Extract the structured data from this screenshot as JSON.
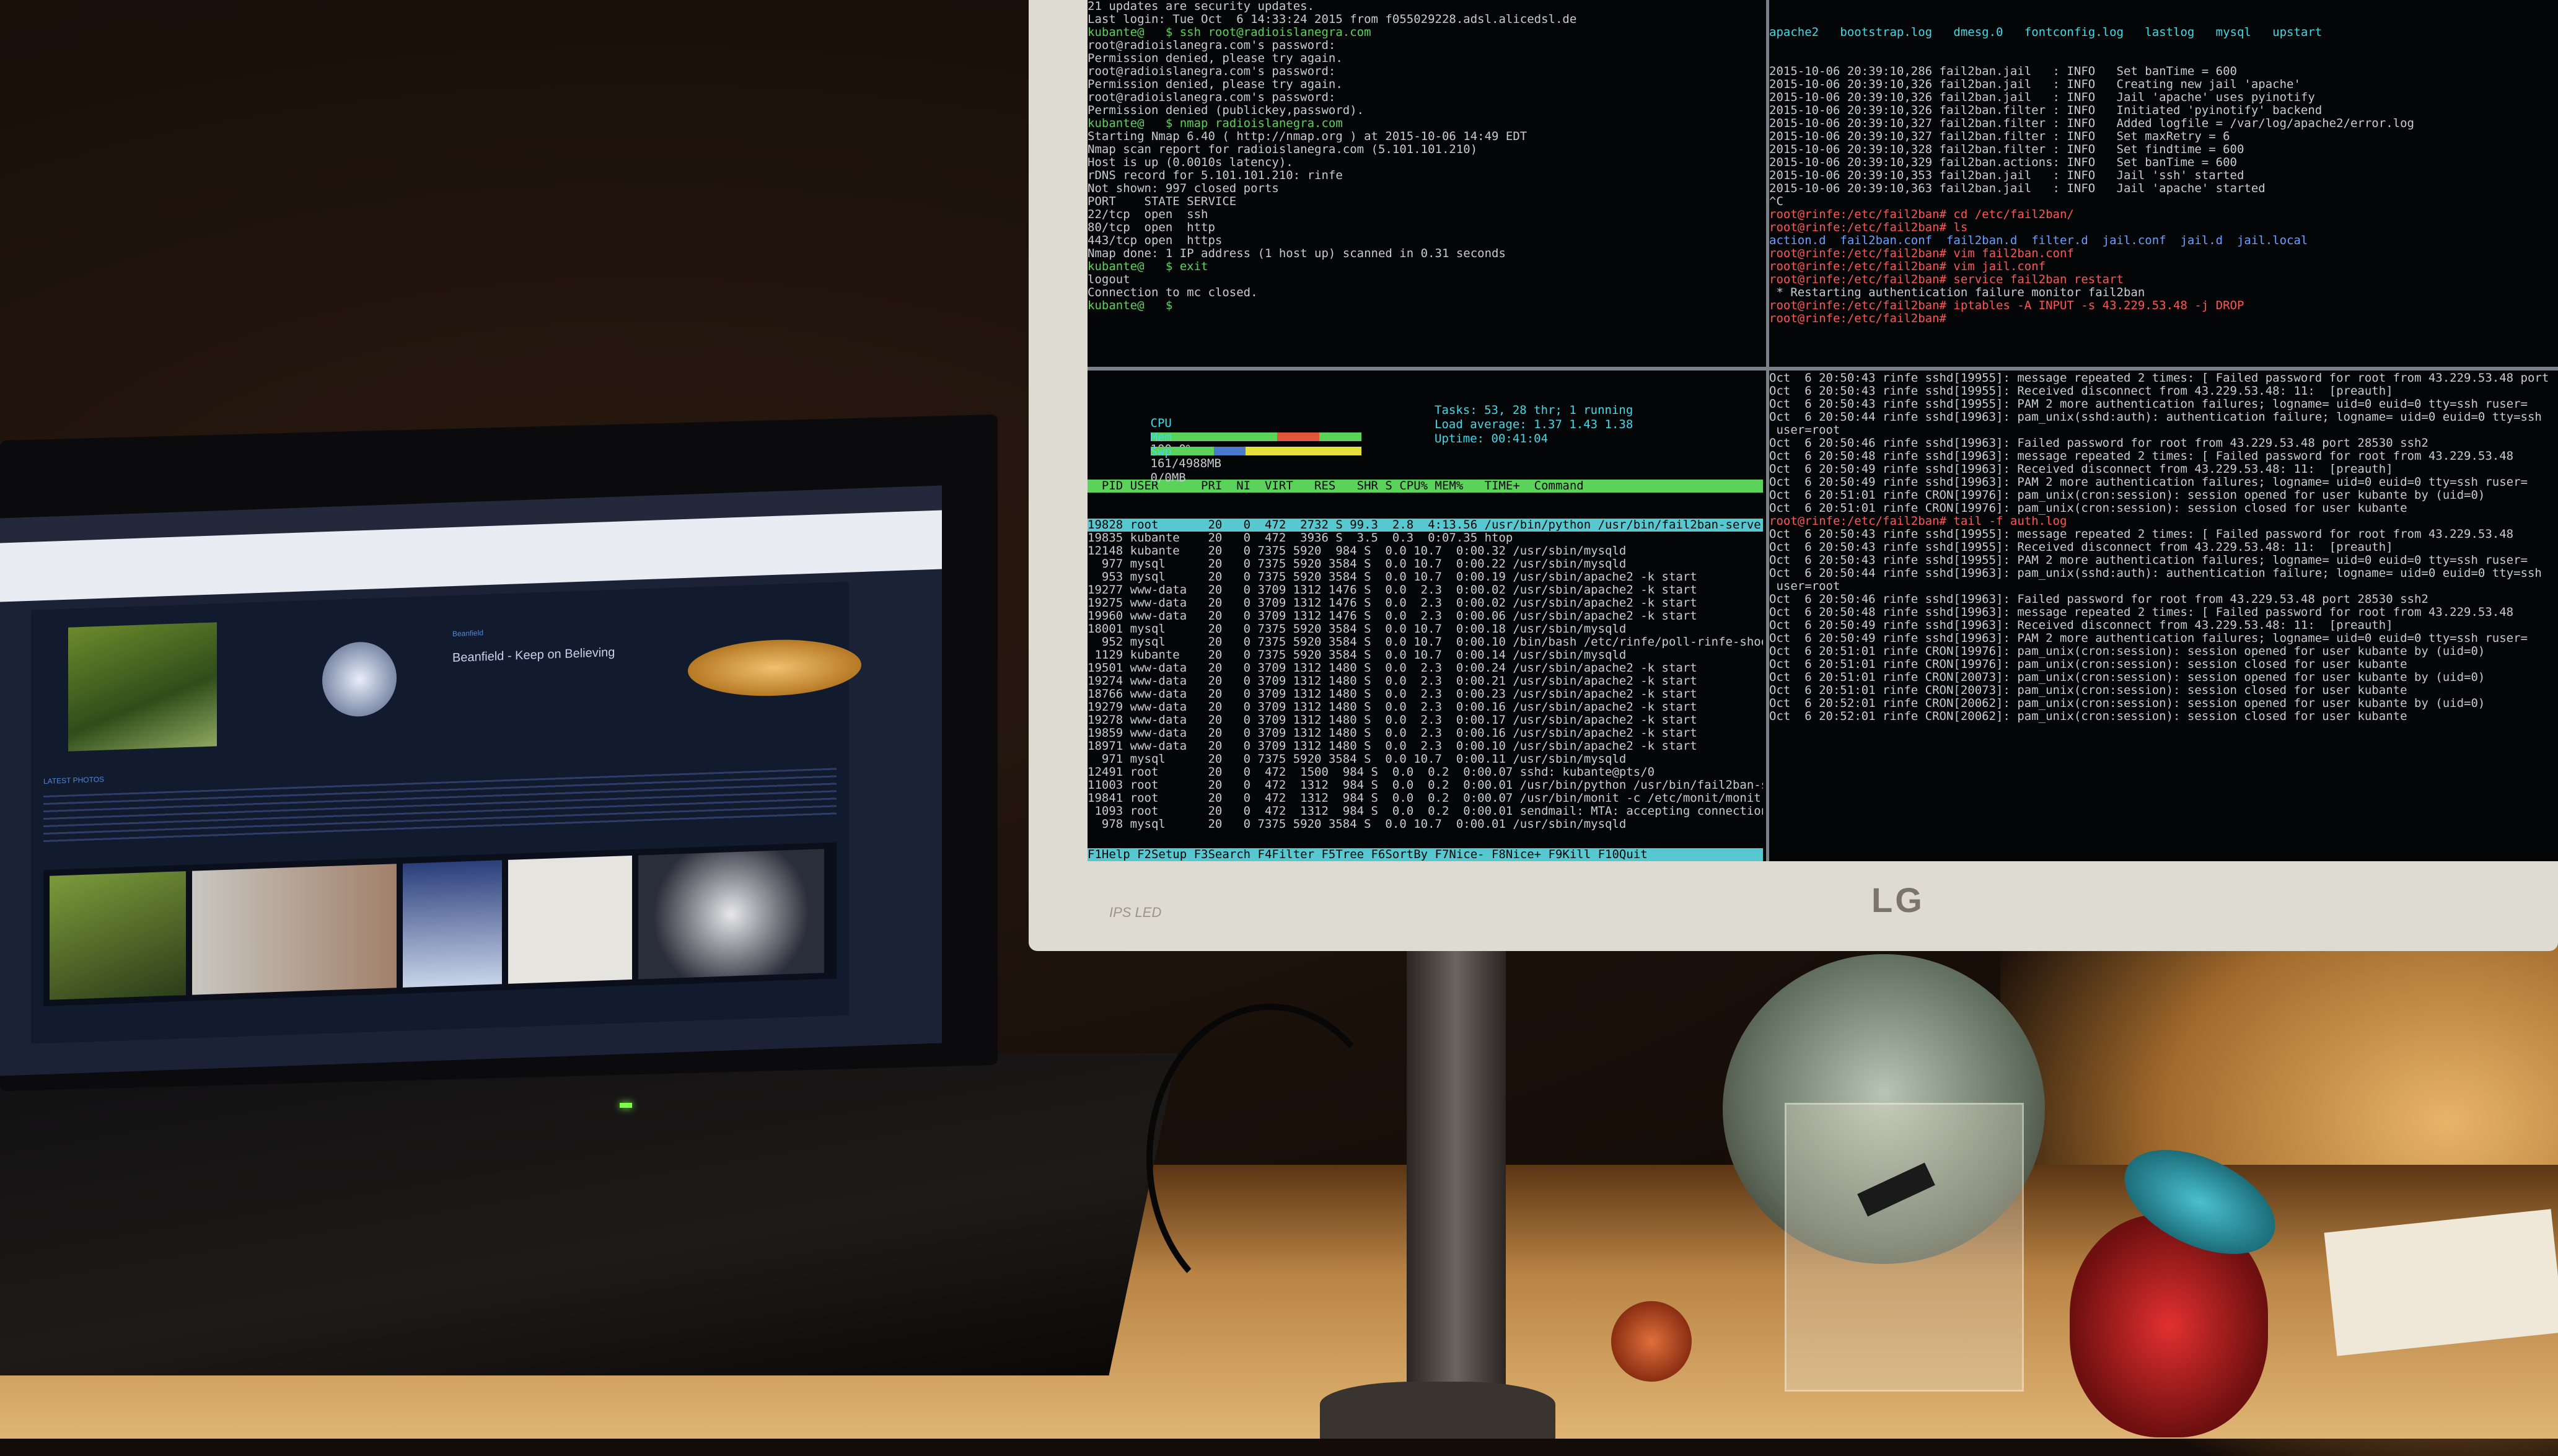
{
  "scene": {
    "monitor_brand": "LG",
    "monitor_badge": "IPS LED"
  },
  "laptop_browser": {
    "site_title": "Beanfield - Keep on Believing",
    "site_subtitle": "Beanfield",
    "section_label": "LATEST PHOTOS"
  },
  "terminal_top_left": {
    "lines": [
      "21 updates are security updates.",
      "Last login: Tue Oct  6 14:33:24 2015 from f055029228.adsl.alicedsl.de",
      "kubante@   $ ssh root@radioislanegra.com",
      "root@radioislanegra.com's password:",
      "Permission denied, please try again.",
      "root@radioislanegra.com's password:",
      "Permission denied, please try again.",
      "root@radioislanegra.com's password:",
      "Permission denied (publickey,password).",
      "kubante@   $ nmap radioislanegra.com",
      "",
      "Starting Nmap 6.40 ( http://nmap.org ) at 2015-10-06 14:49 EDT",
      "Nmap scan report for radioislanegra.com (5.101.101.210)",
      "Host is up (0.0010s latency).",
      "rDNS record for 5.101.101.210: rinfe",
      "Not shown: 997 closed ports",
      "PORT    STATE SERVICE",
      "22/tcp  open  ssh",
      "80/tcp  open  http",
      "443/tcp open  https",
      "",
      "Nmap done: 1 IP address (1 host up) scanned in 0.31 seconds",
      "kubante@   $ exit",
      "logout",
      "Connection to mc closed.",
      "kubante@   $"
    ]
  },
  "terminal_top_right": {
    "header": "apache2   bootstrap.log   dmesg.0   fontconfig.log   lastlog   mysql   upstart",
    "lines": [
      "2015-10-06 20:39:10,286 fail2ban.jail   : INFO   Set banTime = 600",
      "2015-10-06 20:39:10,326 fail2ban.jail   : INFO   Creating new jail 'apache'",
      "2015-10-06 20:39:10,326 fail2ban.jail   : INFO   Jail 'apache' uses pyinotify",
      "2015-10-06 20:39:10,326 fail2ban.filter : INFO   Initiated 'pyinotify' backend",
      "2015-10-06 20:39:10,327 fail2ban.filter : INFO   Added logfile = /var/log/apache2/error.log",
      "2015-10-06 20:39:10,327 fail2ban.filter : INFO   Set maxRetry = 6",
      "2015-10-06 20:39:10,328 fail2ban.filter : INFO   Set findtime = 600",
      "2015-10-06 20:39:10,329 fail2ban.actions: INFO   Set banTime = 600",
      "2015-10-06 20:39:10,353 fail2ban.jail   : INFO   Jail 'ssh' started",
      "2015-10-06 20:39:10,363 fail2ban.jail   : INFO   Jail 'apache' started",
      "^C",
      "root@rinfe:/etc/fail2ban# cd /etc/fail2ban/",
      "root@rinfe:/etc/fail2ban# ls",
      "action.d  fail2ban.conf  fail2ban.d  filter.d  jail.conf  jail.d  jail.local",
      "root@rinfe:/etc/fail2ban# vim fail2ban.conf",
      "root@rinfe:/etc/fail2ban# vim jail.conf",
      "root@rinfe:/etc/fail2ban# service fail2ban restart",
      " * Restarting authentication failure monitor fail2ban",
      "root@rinfe:/etc/fail2ban# iptables -A INPUT -s 43.229.53.48 -j DROP",
      "root@rinfe:/etc/fail2ban# "
    ]
  },
  "htop": {
    "tasks_label": "Tasks: 53, 28 thr; 1 running",
    "load_label": "Load average: 1.37 1.43 1.38",
    "uptime_label": "Uptime: 00:41:04",
    "cpu_label": "CPU",
    "cpu_value": "100.0%",
    "mem_label": "Mem",
    "mem_value": "161/4988MB",
    "swp_label": "Swp",
    "swp_value": "0/0MB",
    "header": "  PID USER      PRI  NI  VIRT   RES   SHR S CPU% MEM%   TIME+  Command",
    "rows": [
      "19828 root       20   0  472  2732 S 99.3  2.8  4:13.56 /usr/bin/python /usr/bin/fail2ban-serve",
      "19835 kubante    20   0  472  3936 S  3.5  0.3  0:07.35 htop",
      "12148 kubante    20   0 7375 5920  984 S  0.0 10.7  0:00.32 /usr/sbin/mysqld",
      "  977 mysql      20   0 7375 5920 3584 S  0.0 10.7  0:00.22 /usr/sbin/mysqld",
      "  953 mysql      20   0 7375 5920 3584 S  0.0 10.7  0:00.19 /usr/sbin/apache2 -k start",
      "19277 www-data   20   0 3709 1312 1476 S  0.0  2.3  0:00.02 /usr/sbin/apache2 -k start",
      "19275 www-data   20   0 3709 1312 1476 S  0.0  2.3  0:00.02 /usr/sbin/apache2 -k start",
      "19960 www-data   20   0 3709 1312 1476 S  0.0  2.3  0:00.06 /usr/sbin/apache2 -k start",
      "18001 mysql      20   0 7375 5920 3584 S  0.0 10.7  0:00.18 /usr/sbin/mysqld",
      "  952 mysql      20   0 7375 5920 3584 S  0.0 10.7  0:00.10 /bin/bash /etc/rinfe/poll-rinfe-shooto",
      " 1129 kubante    20   0 7375 5920 3584 S  0.0 10.7  0:00.14 /usr/sbin/mysqld",
      "19501 www-data   20   0 3709 1312 1480 S  0.0  2.3  0:00.24 /usr/sbin/apache2 -k start",
      "19274 www-data   20   0 3709 1312 1480 S  0.0  2.3  0:00.21 /usr/sbin/apache2 -k start",
      "18766 www-data   20   0 3709 1312 1480 S  0.0  2.3  0:00.23 /usr/sbin/apache2 -k start",
      "19279 www-data   20   0 3709 1312 1480 S  0.0  2.3  0:00.16 /usr/sbin/apache2 -k start",
      "19278 www-data   20   0 3709 1312 1480 S  0.0  2.3  0:00.17 /usr/sbin/apache2 -k start",
      "19859 www-data   20   0 3709 1312 1480 S  0.0  2.3  0:00.16 /usr/sbin/apache2 -k start",
      "18971 www-data   20   0 3709 1312 1480 S  0.0  2.3  0:00.10 /usr/sbin/apache2 -k start",
      "  971 mysql      20   0 7375 5920 3584 S  0.0 10.7  0:00.11 /usr/sbin/mysqld",
      "12491 root       20   0  472  1500  984 S  0.0  0.2  0:00.07 sshd: kubante@pts/0",
      "11003 root       20   0  472  1312  984 S  0.0  0.2  0:00.01 /usr/bin/python /usr/bin/fail2ban-serv",
      "19841 root       20   0  472  1312  984 S  0.0  0.2  0:00.07 /usr/bin/monit -c /etc/monit/monitrc",
      " 1093 root       20   0  472  1312  984 S  0.0  0.2  0:00.01 sendmail: MTA: accepting connections",
      "  978 mysql      20   0 7375 5920 3584 S  0.0 10.7  0:00.01 /usr/sbin/mysqld"
    ],
    "footer": "F1Help F2Setup F3Search F4Filter F5Tree F6SortBy F7Nice- F8Nice+ F9Kill F10Quit"
  },
  "terminal_bottom_right": {
    "lines": [
      "Oct  6 20:50:43 rinfe sshd[19955]: message repeated 2 times: [ Failed password for root from 43.229.53.48 port",
      "Oct  6 20:50:43 rinfe sshd[19955]: Received disconnect from 43.229.53.48: 11:  [preauth]",
      "Oct  6 20:50:43 rinfe sshd[19955]: PAM 2 more authentication failures; logname= uid=0 euid=0 tty=ssh ruser=",
      "",
      "Oct  6 20:50:44 rinfe sshd[19963]: pam_unix(sshd:auth): authentication failure; logname= uid=0 euid=0 tty=ssh",
      " user=root",
      "Oct  6 20:50:46 rinfe sshd[19963]: Failed password for root from 43.229.53.48 port 28530 ssh2",
      "Oct  6 20:50:48 rinfe sshd[19963]: message repeated 2 times: [ Failed password for root from 43.229.53.48",
      "Oct  6 20:50:49 rinfe sshd[19963]: Received disconnect from 43.229.53.48: 11:  [preauth]",
      "Oct  6 20:50:49 rinfe sshd[19963]: PAM 2 more authentication failures; logname= uid=0 euid=0 tty=ssh ruser=",
      "",
      "Oct  6 20:51:01 rinfe CRON[19976]: pam_unix(cron:session): session opened for user kubante by (uid=0)",
      "Oct  6 20:51:01 rinfe CRON[19976]: pam_unix(cron:session): session closed for user kubante",
      "",
      "root@rinfe:/etc/fail2ban# tail -f auth.log",
      "Oct  6 20:50:43 rinfe sshd[19955]: message repeated 2 times: [ Failed password for root from 43.229.53.48",
      "Oct  6 20:50:43 rinfe sshd[19955]: Received disconnect from 43.229.53.48: 11:  [preauth]",
      "Oct  6 20:50:43 rinfe sshd[19955]: PAM 2 more authentication failures; logname= uid=0 euid=0 tty=ssh ruser=",
      "",
      "Oct  6 20:50:44 rinfe sshd[19963]: pam_unix(sshd:auth): authentication failure; logname= uid=0 euid=0 tty=ssh",
      " user=root",
      "Oct  6 20:50:46 rinfe sshd[19963]: Failed password for root from 43.229.53.48 port 28530 ssh2",
      "Oct  6 20:50:48 rinfe sshd[19963]: message repeated 2 times: [ Failed password for root from 43.229.53.48",
      "Oct  6 20:50:49 rinfe sshd[19963]: Received disconnect from 43.229.53.48: 11:  [preauth]",
      "Oct  6 20:50:49 rinfe sshd[19963]: PAM 2 more authentication failures; logname= uid=0 euid=0 tty=ssh ruser=",
      "",
      "Oct  6 20:51:01 rinfe CRON[19976]: pam_unix(cron:session): session opened for user kubante by (uid=0)",
      "Oct  6 20:51:01 rinfe CRON[19976]: pam_unix(cron:session): session closed for user kubante",
      "Oct  6 20:51:01 rinfe CRON[20073]: pam_unix(cron:session): session opened for user kubante by (uid=0)",
      "Oct  6 20:51:01 rinfe CRON[20073]: pam_unix(cron:session): session closed for user kubante",
      "Oct  6 20:52:01 rinfe CRON[20062]: pam_unix(cron:session): session opened for user kubante by (uid=0)",
      "Oct  6 20:52:01 rinfe CRON[20062]: pam_unix(cron:session): session closed for user kubante"
    ]
  },
  "colors": {
    "terminal_bg": "#040506",
    "prompt_green": "#5bd35b",
    "root_red": "#c0392b",
    "htop_cyan": "#44d9e6",
    "monitor_bezel": "#dedbd2"
  }
}
